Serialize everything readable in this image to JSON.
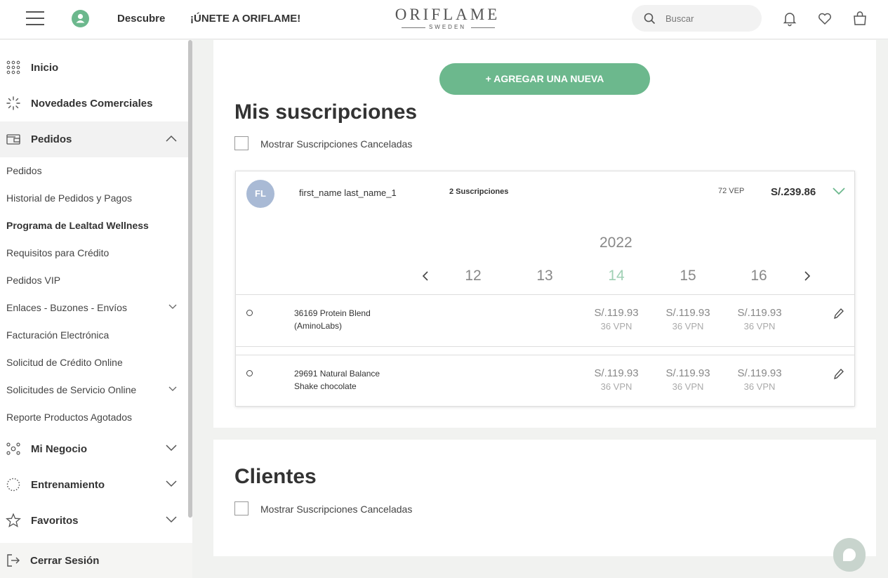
{
  "header": {
    "nav_descubre": "Descubre",
    "nav_join": "¡ÚNETE A ORIFLAME!",
    "logo_main": "ORIFLAME",
    "logo_sub": "SWEDEN",
    "search_placeholder": "Buscar"
  },
  "sidebar": {
    "items": [
      {
        "label": "Inicio",
        "icon": "grid-dots-icon"
      },
      {
        "label": "Novedades Comerciales",
        "icon": "sparkle-icon"
      },
      {
        "label": "Pedidos",
        "icon": "wallet-icon"
      },
      {
        "label": "Mi Negocio",
        "icon": "network-icon"
      },
      {
        "label": "Entrenamiento",
        "icon": "dotted-circle-icon"
      },
      {
        "label": "Favoritos",
        "icon": "star-icon"
      }
    ],
    "pedidos_sub": [
      "Pedidos",
      "Historial de Pedidos y Pagos",
      "Programa de Lealtad Wellness",
      "Requisitos para Crédito",
      "Pedidos VIP",
      "Enlaces - Buzones - Envíos",
      "Facturación Electrónica",
      "Solicitud de Crédito Online",
      "Solicitudes de Servicio Online",
      "Reporte Productos Agotados"
    ],
    "logout": "Cerrar Sesión"
  },
  "subscriptions": {
    "add_button": "+ AGREGAR UNA NUEVA",
    "title": "Mis suscripciones",
    "show_cancelled": "Mostrar Suscripciones Canceladas",
    "customer": {
      "initials": "FL",
      "name": "first_name last_name_1",
      "count": "2 Suscripciones",
      "vep": "72 VEP",
      "total": "S/.239.86"
    },
    "year": "2022",
    "days": [
      "12",
      "13",
      "14",
      "15",
      "16"
    ],
    "rows": [
      {
        "product_line1": "36169 Protein Blend",
        "product_line2": "(AminoLabs)",
        "prices": [
          {
            "price": "S/.119.93",
            "vpn": "36 VPN"
          },
          {
            "price": "S/.119.93",
            "vpn": "36 VPN"
          },
          {
            "price": "S/.119.93",
            "vpn": "36 VPN"
          }
        ]
      },
      {
        "product_line1": "29691 Natural Balance",
        "product_line2": "Shake chocolate",
        "prices": [
          {
            "price": "S/.119.93",
            "vpn": "36 VPN"
          },
          {
            "price": "S/.119.93",
            "vpn": "36 VPN"
          },
          {
            "price": "S/.119.93",
            "vpn": "36 VPN"
          }
        ]
      }
    ]
  },
  "clients": {
    "title": "Clientes",
    "show_cancelled": "Mostrar Suscripciones Canceladas"
  },
  "colors": {
    "brand_green": "#6cb88d",
    "active_day": "#9fd0b4",
    "avatar": "#a9bad5"
  }
}
